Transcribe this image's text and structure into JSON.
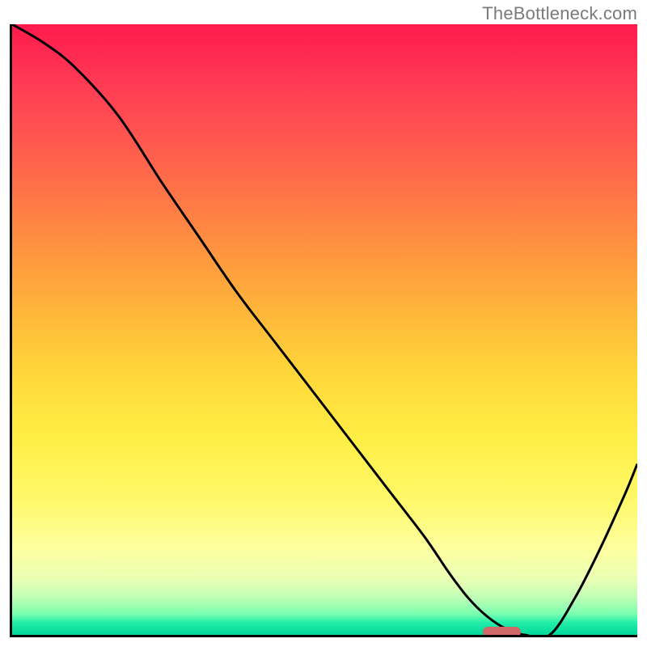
{
  "watermark": "TheBottleneck.com",
  "colors": {
    "gradient_top": "#ff1a4d",
    "gradient_bottom": "#00d89a",
    "axis": "#000000",
    "curve": "#000000",
    "marker": "#d06868",
    "watermark_text": "#7a7a7a"
  },
  "chart_data": {
    "type": "line",
    "title": "",
    "xlabel": "",
    "ylabel": "",
    "xlim": [
      0,
      100
    ],
    "ylim": [
      0,
      100
    ],
    "grid": false,
    "legend": null,
    "series": [
      {
        "name": "bottleneck-curve",
        "x": [
          0,
          5,
          10,
          17,
          24,
          30,
          36,
          42,
          48,
          54,
          60,
          66,
          70,
          73,
          76,
          79,
          82,
          86,
          90,
          94,
          98,
          100
        ],
        "values": [
          100,
          97,
          93,
          85,
          74,
          65,
          56,
          48,
          40,
          32,
          24,
          16,
          10,
          6,
          3,
          1,
          0,
          0,
          6,
          14,
          23,
          28
        ]
      }
    ],
    "annotations": [
      {
        "name": "optimal-marker",
        "x_center": 78,
        "y": 0,
        "width": 6
      }
    ]
  }
}
